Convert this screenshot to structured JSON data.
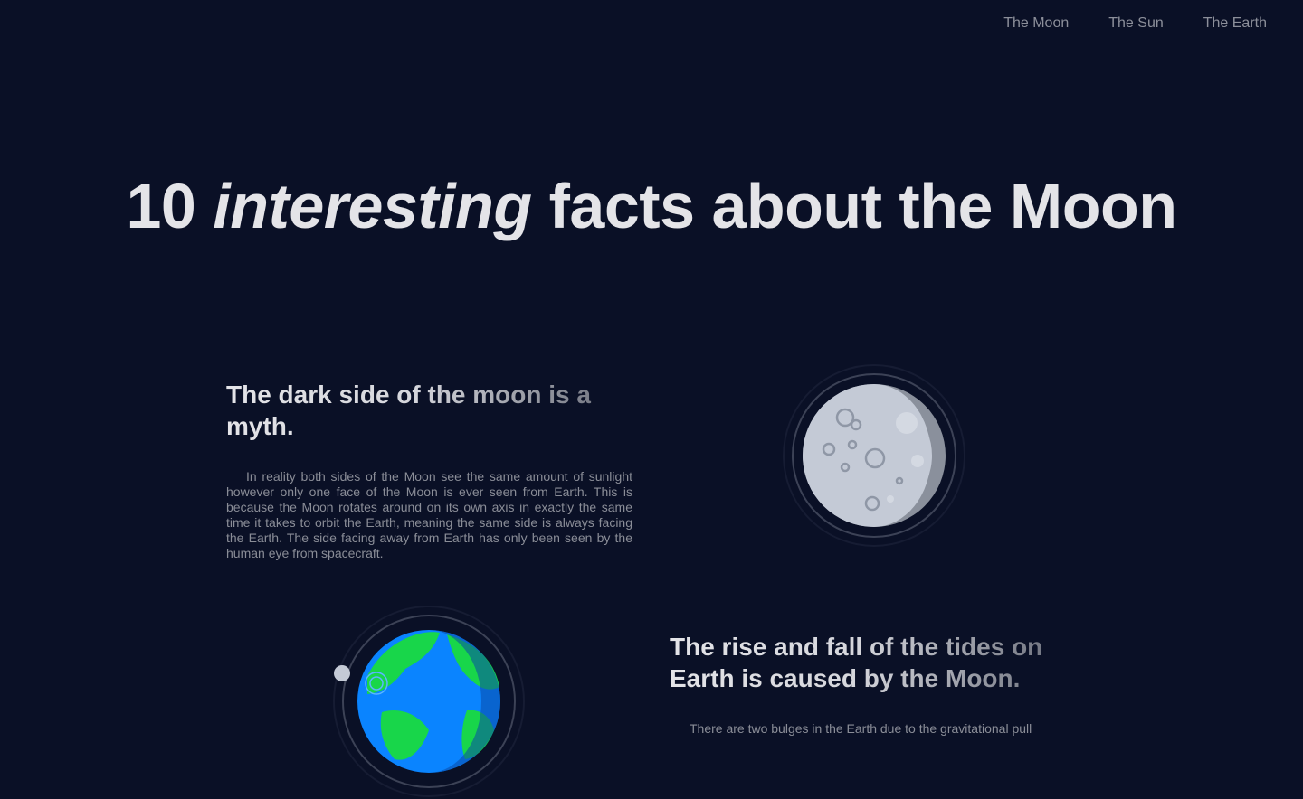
{
  "nav": {
    "items": [
      {
        "label": "The Moon"
      },
      {
        "label": "The Sun"
      },
      {
        "label": "The Earth"
      }
    ]
  },
  "hero": {
    "prefix": "10",
    "emphasis": "interesting",
    "suffix": "facts about the Moon"
  },
  "facts": [
    {
      "title": "The dark side of the moon is a myth.",
      "body": "In reality both sides of the Moon see the same amount of sunlight however only one face of the Moon is ever seen from Earth. This is because the Moon rotates around on its own axis in exactly the same time it takes to orbit the Earth, meaning the same side is always facing the Earth. The side facing away from Earth has only been seen by the human eye from spacecraft.",
      "illustration": "moon-illustration"
    },
    {
      "title": "The rise and fall of the tides on Earth is caused by the Moon.",
      "body": "There are two bulges in the Earth due to the gravitational pull",
      "illustration": "earth-illustration"
    }
  ],
  "colors": {
    "background": "#0a1026",
    "heading": "#e4e4e8",
    "body_text": "#8a8d97",
    "nav_text": "#8c8f9a",
    "moon_light": "#c4cad6",
    "moon_shadow": "#8a909c",
    "earth_ocean": "#0a84ff",
    "earth_land": "#18d64a"
  }
}
